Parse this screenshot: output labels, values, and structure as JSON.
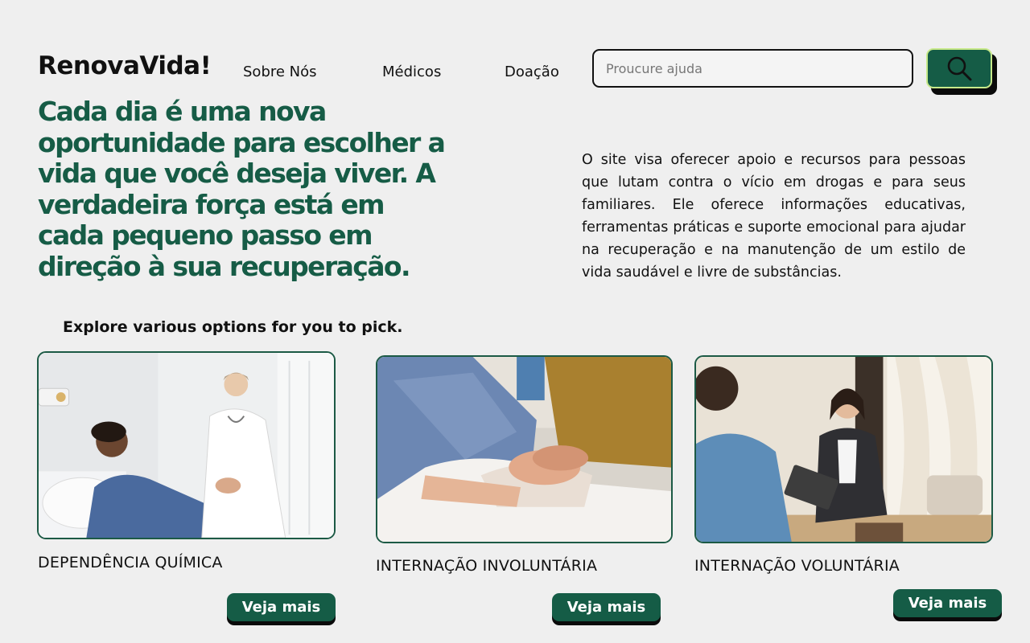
{
  "brand": {
    "logo": "RenovaVida!"
  },
  "nav": {
    "items": [
      {
        "label": "Sobre Nós"
      },
      {
        "label": "Médicos"
      },
      {
        "label": "Doação"
      }
    ]
  },
  "search": {
    "placeholder": "Proucure ajuda",
    "value": "",
    "icon": "search-icon"
  },
  "hero": {
    "headline": "Cada dia é uma nova oportunidade para escolher a vida que você deseja viver. A verdadeira força está em cada pequeno passo em direção à sua recuperação.",
    "description": "O site visa oferecer apoio e recursos para pessoas que lutam contra o vício em drogas e para seus familiares. Ele oferece informações educativas, ferramentas práticas e suporte emocional para ajudar na recuperação e na manutenção de um estilo de vida saudável e livre de substâncias."
  },
  "options": {
    "heading": "Explore various options for you to pick.",
    "cards": [
      {
        "title": "DEPENDÊNCIA QUÍMICA",
        "button": "Veja mais",
        "image": "doctor-holding-patient-hands-photo"
      },
      {
        "title": "INTERNAÇÃO INVOLUNTÁRIA",
        "button": "Veja mais",
        "image": "holding-hands-hospital-bed-photo"
      },
      {
        "title": "INTERNAÇÃO VOLUNTÁRIA",
        "button": "Veja mais",
        "image": "therapist-session-photo"
      }
    ]
  },
  "colors": {
    "brand_green": "#155c46",
    "headline_green": "#165c46",
    "background": "#efefef",
    "search_button_border": "#c7e98a"
  }
}
